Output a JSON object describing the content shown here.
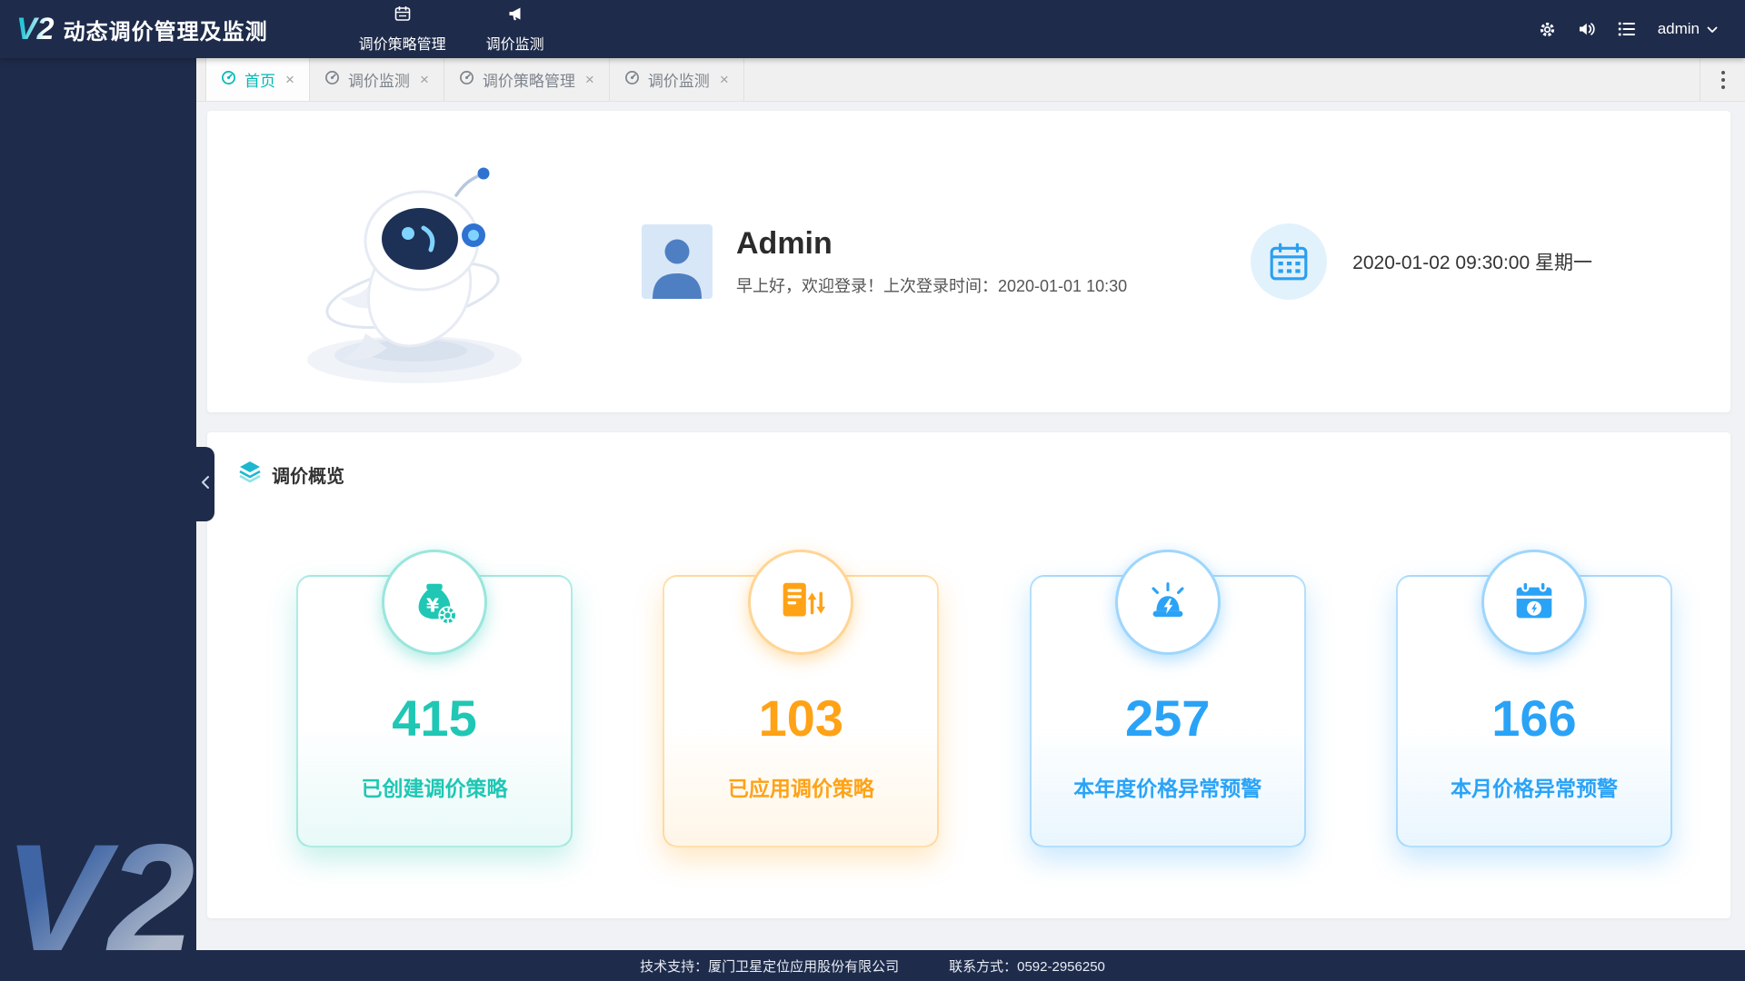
{
  "app": {
    "logo": "V2",
    "title": "动态调价管理及监测",
    "watermark": "V2"
  },
  "theme": {
    "navy": "#1e2b4a",
    "active_tab": "#00b9b4",
    "teal": "#1fc7b4",
    "orange": "#ffa216",
    "blue": "#2aa3f7"
  },
  "icons": {
    "close": "×"
  },
  "navbar": {
    "menu": [
      {
        "label": "调价策略管理"
      },
      {
        "label": "调价监测"
      }
    ],
    "user": {
      "name": "admin"
    }
  },
  "tabbar": {
    "tabs": [
      {
        "label": "首页"
      },
      {
        "label": "调价监测"
      },
      {
        "label": "调价策略管理"
      },
      {
        "label": "调价监测"
      }
    ]
  },
  "welcome": {
    "username": "Admin",
    "greeting": "早上好，欢迎登录！上次登录时间：2020-01-01 10:30",
    "datetime": "2020-01-02 09:30:00 星期一"
  },
  "overview": {
    "title": "调价概览",
    "stats": [
      {
        "value": "415",
        "label": "已创建调价策略",
        "color": "#1fc7b4"
      },
      {
        "value": "103",
        "label": "已应用调价策略",
        "color": "#ffa216"
      },
      {
        "value": "257",
        "label": "本年度价格异常预警",
        "color": "#2aa3f7"
      },
      {
        "value": "166",
        "label": "本月价格异常预警",
        "color": "#2aa3f7"
      }
    ]
  },
  "footer": {
    "support": "技术支持：厦门卫星定位应用股份有限公司",
    "contact": "联系方式：0592-2956250"
  }
}
